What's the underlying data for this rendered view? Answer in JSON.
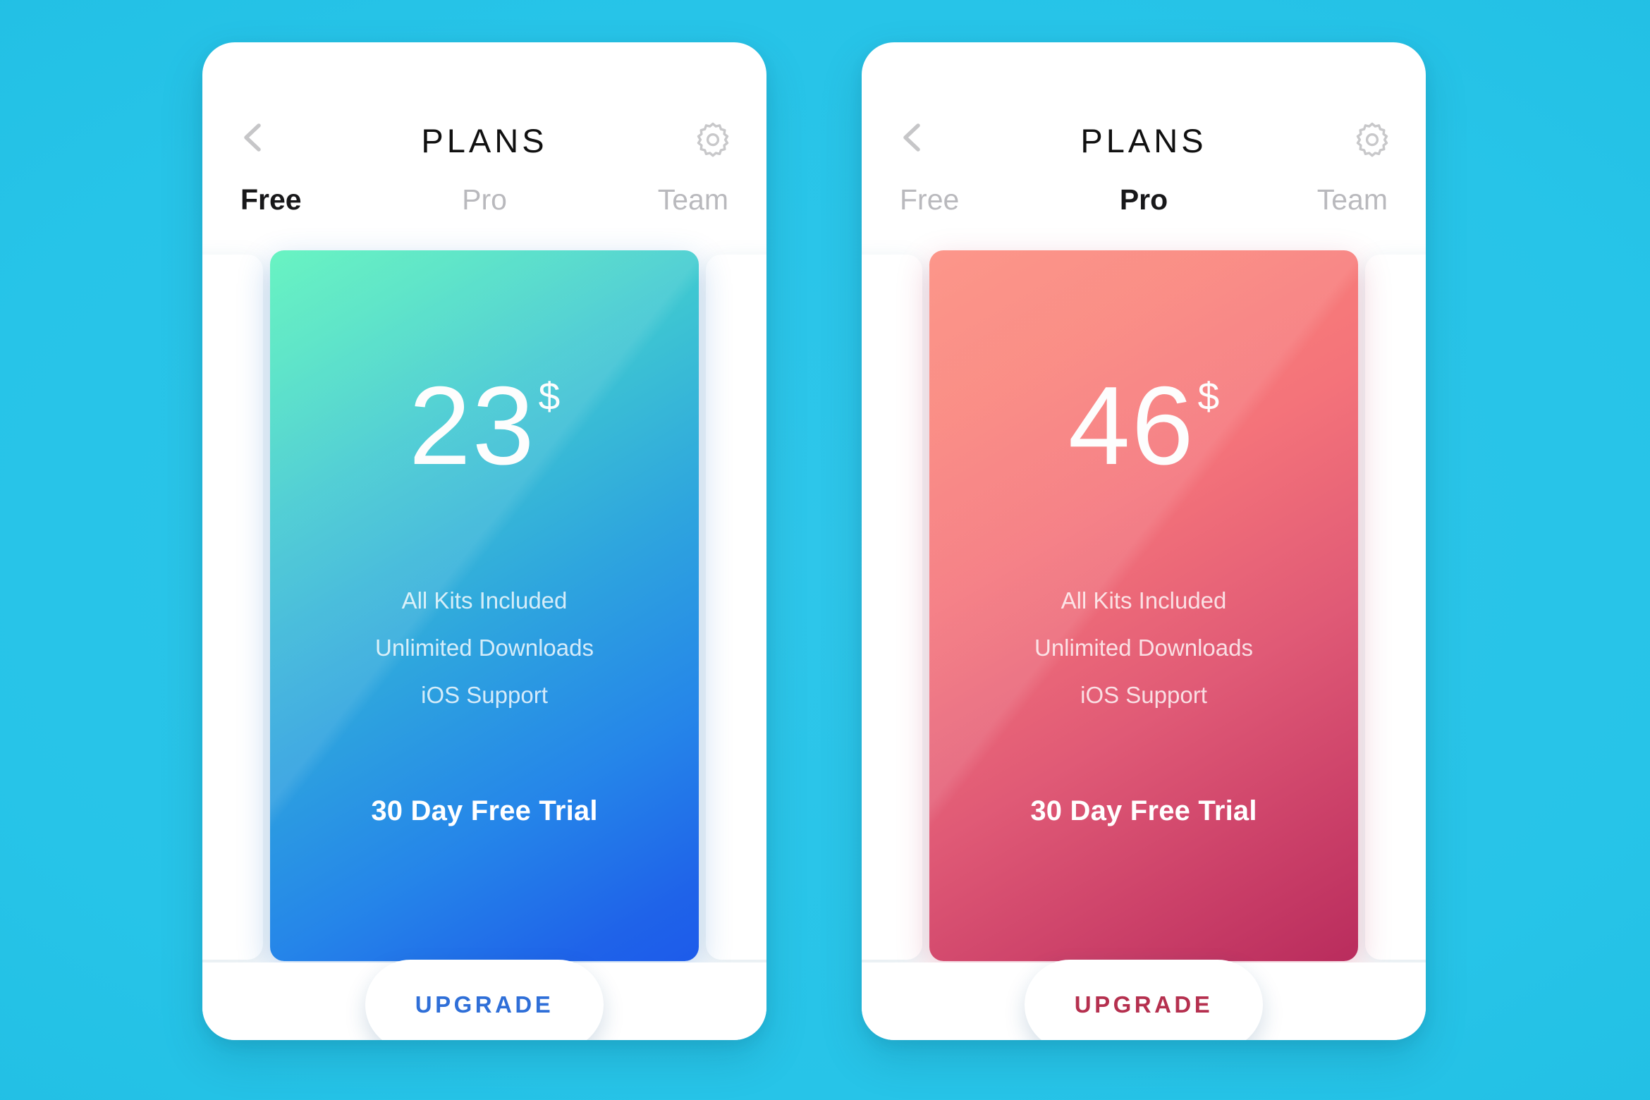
{
  "background": {
    "color": "#27c4e8"
  },
  "screens": [
    {
      "id": "free-plan-screen",
      "header": {
        "title": "PLANS",
        "back_icon": "chevron-left-icon",
        "settings_icon": "gear-icon"
      },
      "tabs": [
        {
          "label": "Free",
          "active": true
        },
        {
          "label": "Pro",
          "active": false
        },
        {
          "label": "Team",
          "active": false
        }
      ],
      "card": {
        "theme": "green",
        "gradient_from": "#58f2bb",
        "gradient_to": "#1d5bea",
        "price": "23",
        "currency": "$",
        "features": [
          "All Kits Included",
          "Unlimited Downloads",
          "iOS Support"
        ],
        "trial": "30 Day Free Trial",
        "cta_label": "UPGRADE",
        "cta_text_color": "#2f6fd8"
      }
    },
    {
      "id": "pro-plan-screen",
      "header": {
        "title": "PLANS",
        "back_icon": "chevron-left-icon",
        "settings_icon": "gear-icon"
      },
      "tabs": [
        {
          "label": "Free",
          "active": false
        },
        {
          "label": "Pro",
          "active": true
        },
        {
          "label": "Team",
          "active": false
        }
      ],
      "card": {
        "theme": "red",
        "gradient_from": "#fc8a7d",
        "gradient_to": "#b92c5d",
        "price": "46",
        "currency": "$",
        "features": [
          "All Kits Included",
          "Unlimited Downloads",
          "iOS Support"
        ],
        "trial": "30 Day Free Trial",
        "cta_label": "UPGRADE",
        "cta_text_color": "#b5304f"
      }
    }
  ]
}
